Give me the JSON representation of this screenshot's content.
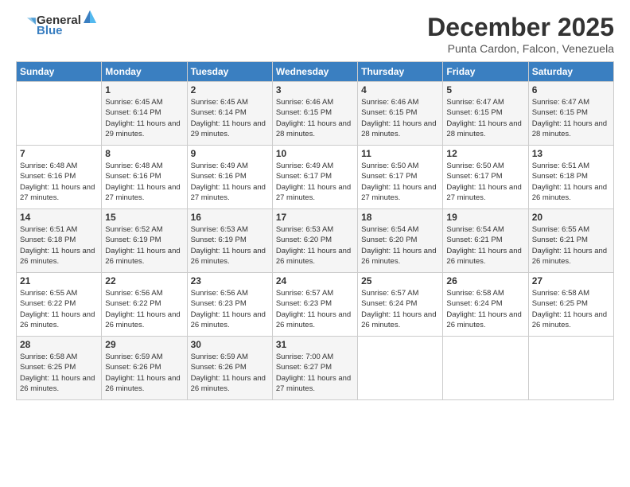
{
  "logo": {
    "general": "General",
    "blue": "Blue"
  },
  "title": "December 2025",
  "location": "Punta Cardon, Falcon, Venezuela",
  "headers": [
    "Sunday",
    "Monday",
    "Tuesday",
    "Wednesday",
    "Thursday",
    "Friday",
    "Saturday"
  ],
  "weeks": [
    [
      {
        "num": "",
        "sunrise": "",
        "sunset": "",
        "daylight": ""
      },
      {
        "num": "1",
        "sunrise": "Sunrise: 6:45 AM",
        "sunset": "Sunset: 6:14 PM",
        "daylight": "Daylight: 11 hours and 29 minutes."
      },
      {
        "num": "2",
        "sunrise": "Sunrise: 6:45 AM",
        "sunset": "Sunset: 6:14 PM",
        "daylight": "Daylight: 11 hours and 29 minutes."
      },
      {
        "num": "3",
        "sunrise": "Sunrise: 6:46 AM",
        "sunset": "Sunset: 6:15 PM",
        "daylight": "Daylight: 11 hours and 28 minutes."
      },
      {
        "num": "4",
        "sunrise": "Sunrise: 6:46 AM",
        "sunset": "Sunset: 6:15 PM",
        "daylight": "Daylight: 11 hours and 28 minutes."
      },
      {
        "num": "5",
        "sunrise": "Sunrise: 6:47 AM",
        "sunset": "Sunset: 6:15 PM",
        "daylight": "Daylight: 11 hours and 28 minutes."
      },
      {
        "num": "6",
        "sunrise": "Sunrise: 6:47 AM",
        "sunset": "Sunset: 6:15 PM",
        "daylight": "Daylight: 11 hours and 28 minutes."
      }
    ],
    [
      {
        "num": "7",
        "sunrise": "Sunrise: 6:48 AM",
        "sunset": "Sunset: 6:16 PM",
        "daylight": "Daylight: 11 hours and 27 minutes."
      },
      {
        "num": "8",
        "sunrise": "Sunrise: 6:48 AM",
        "sunset": "Sunset: 6:16 PM",
        "daylight": "Daylight: 11 hours and 27 minutes."
      },
      {
        "num": "9",
        "sunrise": "Sunrise: 6:49 AM",
        "sunset": "Sunset: 6:16 PM",
        "daylight": "Daylight: 11 hours and 27 minutes."
      },
      {
        "num": "10",
        "sunrise": "Sunrise: 6:49 AM",
        "sunset": "Sunset: 6:17 PM",
        "daylight": "Daylight: 11 hours and 27 minutes."
      },
      {
        "num": "11",
        "sunrise": "Sunrise: 6:50 AM",
        "sunset": "Sunset: 6:17 PM",
        "daylight": "Daylight: 11 hours and 27 minutes."
      },
      {
        "num": "12",
        "sunrise": "Sunrise: 6:50 AM",
        "sunset": "Sunset: 6:17 PM",
        "daylight": "Daylight: 11 hours and 27 minutes."
      },
      {
        "num": "13",
        "sunrise": "Sunrise: 6:51 AM",
        "sunset": "Sunset: 6:18 PM",
        "daylight": "Daylight: 11 hours and 26 minutes."
      }
    ],
    [
      {
        "num": "14",
        "sunrise": "Sunrise: 6:51 AM",
        "sunset": "Sunset: 6:18 PM",
        "daylight": "Daylight: 11 hours and 26 minutes."
      },
      {
        "num": "15",
        "sunrise": "Sunrise: 6:52 AM",
        "sunset": "Sunset: 6:19 PM",
        "daylight": "Daylight: 11 hours and 26 minutes."
      },
      {
        "num": "16",
        "sunrise": "Sunrise: 6:53 AM",
        "sunset": "Sunset: 6:19 PM",
        "daylight": "Daylight: 11 hours and 26 minutes."
      },
      {
        "num": "17",
        "sunrise": "Sunrise: 6:53 AM",
        "sunset": "Sunset: 6:20 PM",
        "daylight": "Daylight: 11 hours and 26 minutes."
      },
      {
        "num": "18",
        "sunrise": "Sunrise: 6:54 AM",
        "sunset": "Sunset: 6:20 PM",
        "daylight": "Daylight: 11 hours and 26 minutes."
      },
      {
        "num": "19",
        "sunrise": "Sunrise: 6:54 AM",
        "sunset": "Sunset: 6:21 PM",
        "daylight": "Daylight: 11 hours and 26 minutes."
      },
      {
        "num": "20",
        "sunrise": "Sunrise: 6:55 AM",
        "sunset": "Sunset: 6:21 PM",
        "daylight": "Daylight: 11 hours and 26 minutes."
      }
    ],
    [
      {
        "num": "21",
        "sunrise": "Sunrise: 6:55 AM",
        "sunset": "Sunset: 6:22 PM",
        "daylight": "Daylight: 11 hours and 26 minutes."
      },
      {
        "num": "22",
        "sunrise": "Sunrise: 6:56 AM",
        "sunset": "Sunset: 6:22 PM",
        "daylight": "Daylight: 11 hours and 26 minutes."
      },
      {
        "num": "23",
        "sunrise": "Sunrise: 6:56 AM",
        "sunset": "Sunset: 6:23 PM",
        "daylight": "Daylight: 11 hours and 26 minutes."
      },
      {
        "num": "24",
        "sunrise": "Sunrise: 6:57 AM",
        "sunset": "Sunset: 6:23 PM",
        "daylight": "Daylight: 11 hours and 26 minutes."
      },
      {
        "num": "25",
        "sunrise": "Sunrise: 6:57 AM",
        "sunset": "Sunset: 6:24 PM",
        "daylight": "Daylight: 11 hours and 26 minutes."
      },
      {
        "num": "26",
        "sunrise": "Sunrise: 6:58 AM",
        "sunset": "Sunset: 6:24 PM",
        "daylight": "Daylight: 11 hours and 26 minutes."
      },
      {
        "num": "27",
        "sunrise": "Sunrise: 6:58 AM",
        "sunset": "Sunset: 6:25 PM",
        "daylight": "Daylight: 11 hours and 26 minutes."
      }
    ],
    [
      {
        "num": "28",
        "sunrise": "Sunrise: 6:58 AM",
        "sunset": "Sunset: 6:25 PM",
        "daylight": "Daylight: 11 hours and 26 minutes."
      },
      {
        "num": "29",
        "sunrise": "Sunrise: 6:59 AM",
        "sunset": "Sunset: 6:26 PM",
        "daylight": "Daylight: 11 hours and 26 minutes."
      },
      {
        "num": "30",
        "sunrise": "Sunrise: 6:59 AM",
        "sunset": "Sunset: 6:26 PM",
        "daylight": "Daylight: 11 hours and 26 minutes."
      },
      {
        "num": "31",
        "sunrise": "Sunrise: 7:00 AM",
        "sunset": "Sunset: 6:27 PM",
        "daylight": "Daylight: 11 hours and 27 minutes."
      },
      {
        "num": "",
        "sunrise": "",
        "sunset": "",
        "daylight": ""
      },
      {
        "num": "",
        "sunrise": "",
        "sunset": "",
        "daylight": ""
      },
      {
        "num": "",
        "sunrise": "",
        "sunset": "",
        "daylight": ""
      }
    ]
  ]
}
